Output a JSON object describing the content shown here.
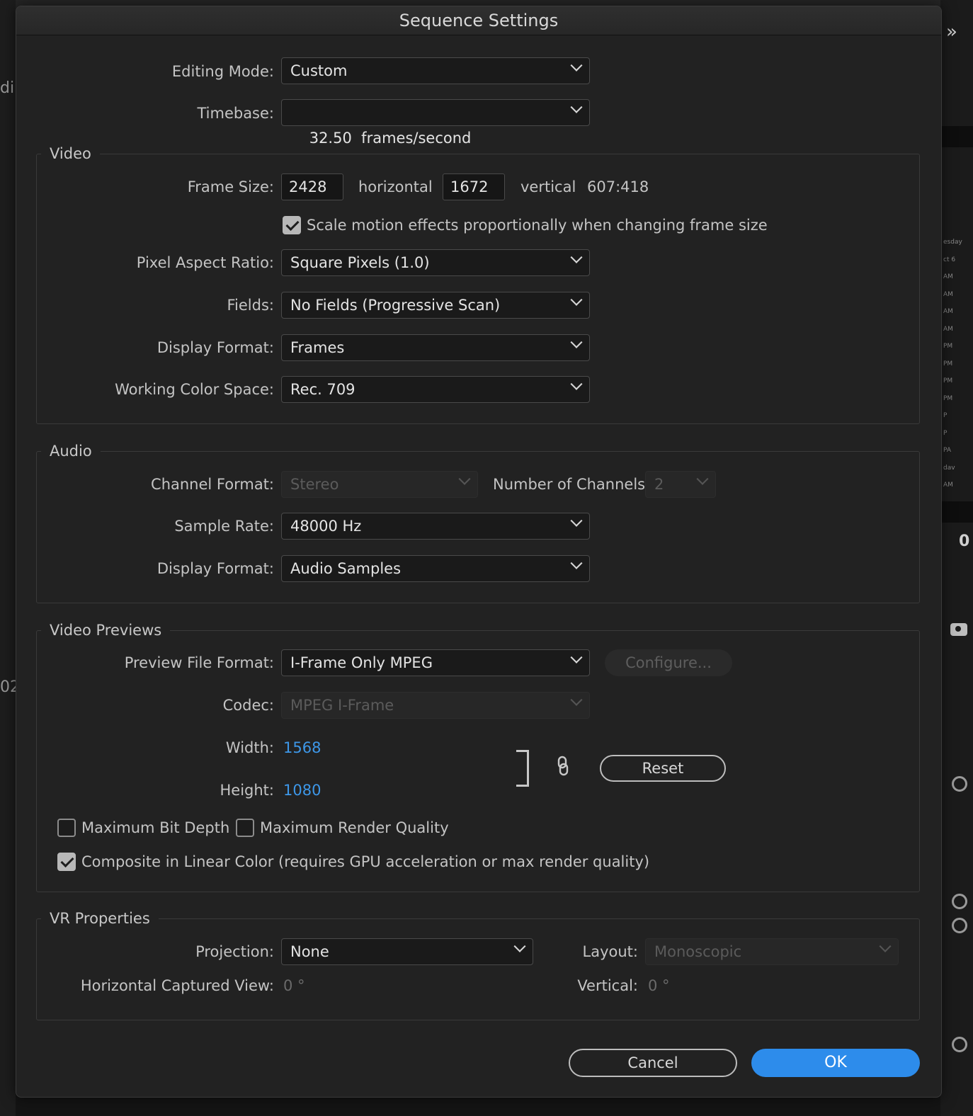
{
  "dialog": {
    "title": "Sequence Settings",
    "editing_mode": {
      "label": "Editing Mode:",
      "value": "Custom"
    },
    "timebase": {
      "label": "Timebase:",
      "value": "32.50  frames/second"
    }
  },
  "video": {
    "title": "Video",
    "frame_size": {
      "label": "Frame Size:",
      "width": "2428",
      "horizontal_label": "horizontal",
      "height": "1672",
      "vertical_label": "vertical",
      "ratio": "607:418"
    },
    "scale_motion": {
      "label": "Scale motion effects proportionally when changing frame size",
      "checked": true
    },
    "pixel_aspect_ratio": {
      "label": "Pixel Aspect Ratio:",
      "value": "Square Pixels (1.0)"
    },
    "fields": {
      "label": "Fields:",
      "value": "No Fields (Progressive Scan)"
    },
    "display_format": {
      "label": "Display Format:",
      "value": "Frames"
    },
    "working_color_space": {
      "label": "Working Color Space:",
      "value": "Rec. 709"
    }
  },
  "audio": {
    "title": "Audio",
    "channel_format": {
      "label": "Channel Format:",
      "value": "Stereo"
    },
    "number_of_channels": {
      "label": "Number of Channels:",
      "value": "2"
    },
    "sample_rate": {
      "label": "Sample Rate:",
      "value": "48000 Hz"
    },
    "display_format": {
      "label": "Display Format:",
      "value": "Audio Samples"
    }
  },
  "video_previews": {
    "title": "Video Previews",
    "preview_file_format": {
      "label": "Preview File Format:",
      "value": "I-Frame Only MPEG"
    },
    "configure_label": "Configure...",
    "codec": {
      "label": "Codec:",
      "value": "MPEG I-Frame"
    },
    "width": {
      "label": "Width:",
      "value": "1568"
    },
    "height": {
      "label": "Height:",
      "value": "1080"
    },
    "reset_label": "Reset",
    "max_bit_depth": {
      "label": "Maximum Bit Depth",
      "checked": false
    },
    "max_render_quality": {
      "label": "Maximum Render Quality",
      "checked": false
    },
    "composite_linear": {
      "label": "Composite in Linear Color (requires GPU acceleration or max render quality)",
      "checked": true
    }
  },
  "vr_properties": {
    "title": "VR Properties",
    "projection": {
      "label": "Projection:",
      "value": "None"
    },
    "layout": {
      "label": "Layout:",
      "value": "Monoscopic"
    },
    "horizontal_captured_view": {
      "label": "Horizontal Captured View:",
      "value": "0 °"
    },
    "vertical": {
      "label": "Vertical:",
      "value": "0 °"
    }
  },
  "buttons": {
    "cancel": "Cancel",
    "ok": "OK"
  },
  "background": {
    "right_ticks": [
      "esday",
      "ct 6",
      "AM",
      "AM",
      "AM",
      "AM",
      "PM",
      "PM",
      "PM",
      "PM",
      "P",
      "P",
      "PA",
      "dav",
      "AM"
    ],
    "right_zero": "0",
    "left_fragment_1": "di",
    "left_fragment_2": "02"
  },
  "colors": {
    "accent": "#2d8ceb",
    "link": "#3d97e8",
    "dialog_bg": "#222222"
  }
}
